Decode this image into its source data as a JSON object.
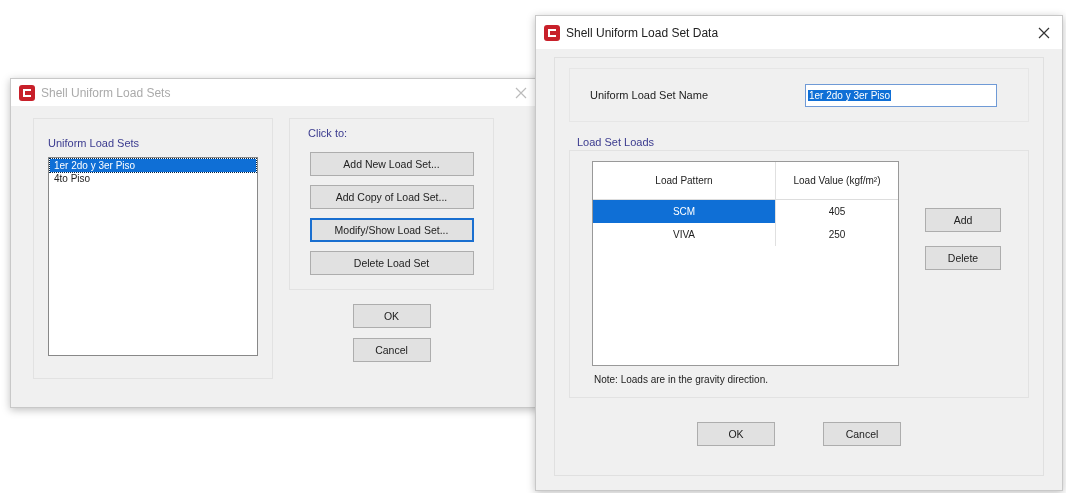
{
  "load_sets_dialog": {
    "title": "Shell Uniform Load Sets",
    "active": false,
    "list_group": {
      "label": "Uniform Load Sets",
      "items": [
        {
          "label": "1er 2do y 3er Piso",
          "selected": true
        },
        {
          "label": "4to Piso",
          "selected": false
        }
      ]
    },
    "actions_group": {
      "label": "Click to:",
      "buttons": [
        {
          "label": "Add New Load Set...",
          "focused": false
        },
        {
          "label": "Add Copy of Load Set...",
          "focused": false
        },
        {
          "label": "Modify/Show Load Set...",
          "focused": true
        },
        {
          "label": "Delete Load Set",
          "focused": false
        }
      ]
    },
    "buttons": [
      "OK",
      "Cancel"
    ]
  },
  "load_set_data_dialog": {
    "title": "Shell Uniform Load Set Data",
    "active": true,
    "name_label": "Uniform Load Set Name",
    "name_value": "1er 2do y 3er Piso",
    "loads_group": {
      "label": "Load Set Loads",
      "columns": [
        "Load Pattern",
        "Load Value (kgf/m²)"
      ],
      "rows": [
        {
          "pattern": "SCM",
          "value": "405",
          "selected": true
        },
        {
          "pattern": "VIVA",
          "value": "250",
          "selected": false
        }
      ],
      "buttons": [
        "Add",
        "Delete"
      ],
      "note": "Note:  Loads are in the gravity direction."
    },
    "buttons": [
      "OK",
      "Cancel"
    ]
  }
}
